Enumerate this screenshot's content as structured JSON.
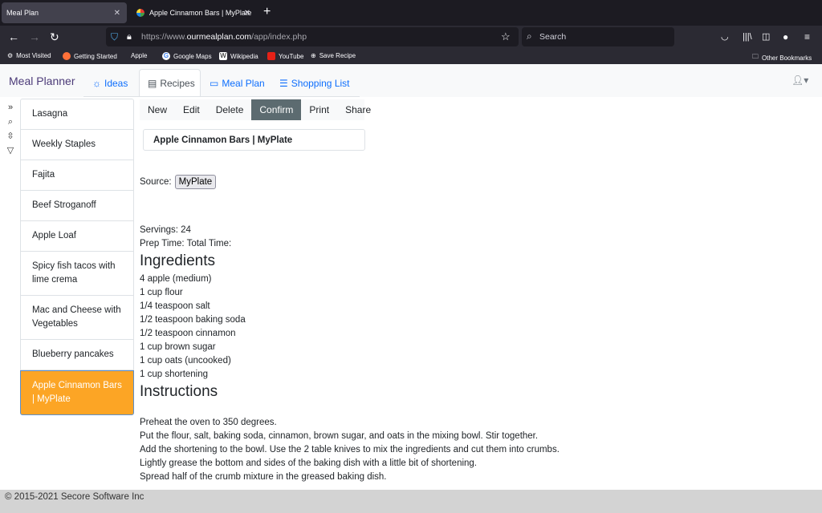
{
  "browser": {
    "tabs": [
      {
        "label": "Meal Plan",
        "active": true
      },
      {
        "label": "Apple Cinnamon Bars | MyPlate",
        "active": false
      }
    ],
    "url": {
      "prefix": "https://www.",
      "domain": "ourmealplan.com",
      "path": "/app/index.php"
    },
    "search_placeholder": "Search",
    "bookmarks": [
      "Most Visited",
      "Getting Started",
      "Apple",
      "Google Maps",
      "Wikipedia",
      "YouTube",
      "Save Recipe"
    ],
    "other_bookmarks": "Other Bookmarks"
  },
  "app": {
    "brand": "Meal Planner",
    "nav": [
      {
        "label": "Ideas",
        "icon": "lightbulb-icon"
      },
      {
        "label": "Recipes",
        "icon": "file-icon"
      },
      {
        "label": "Meal Plan",
        "icon": "calendar-icon"
      },
      {
        "label": "Shopping List",
        "icon": "list-icon"
      }
    ],
    "active_nav": "Recipes"
  },
  "sidebar": {
    "tools": [
      "expand-icon",
      "search-icon",
      "sort-icon",
      "filter-icon"
    ],
    "recipes": [
      "Lasagna",
      "Weekly Staples",
      "Fajita",
      "Beef Stroganoff",
      "Apple Loaf",
      "Spicy fish tacos with lime crema",
      "Mac and Cheese with Vegetables",
      "Blueberry pancakes",
      "Apple Cinnamon Bars | MyPlate"
    ],
    "selected": "Apple Cinnamon Bars | MyPlate"
  },
  "toolbar": {
    "buttons": [
      "New",
      "Edit",
      "Delete",
      "Confirm",
      "Print",
      "Share"
    ],
    "active": "Confirm"
  },
  "recipe": {
    "title": "Apple Cinnamon Bars | MyPlate",
    "source_label": "Source:",
    "source": "MyPlate",
    "servings": "Servings: 24",
    "times": "Prep Time: Total Time:",
    "ingredients_heading": "Ingredients",
    "ingredients": [
      "4 apple (medium)",
      "1 cup flour",
      "1/4 teaspoon salt",
      "1/2 teaspoon baking soda",
      "1/2 teaspoon cinnamon",
      "1 cup brown sugar",
      "1 cup oats (uncooked)",
      "1 cup shortening"
    ],
    "instructions_heading": "Instructions",
    "instructions": [
      "Preheat the oven to 350 degrees.",
      "Put the flour, salt, baking soda, cinnamon, brown sugar, and oats in the mixing bowl. Stir together.",
      "Add the shortening to the bowl. Use the 2 table knives to mix the ingredients and cut them into crumbs.",
      "Lightly grease the bottom and sides of the baking dish with a little bit of shortening.",
      "Spread half of the crumb mixture in the greased baking dish."
    ]
  },
  "footer": "© 2015-2021 Secore Software Inc",
  "colors": {
    "selected": "#fca525",
    "confirm": "#5c6b70",
    "link": "#0d6efd"
  }
}
